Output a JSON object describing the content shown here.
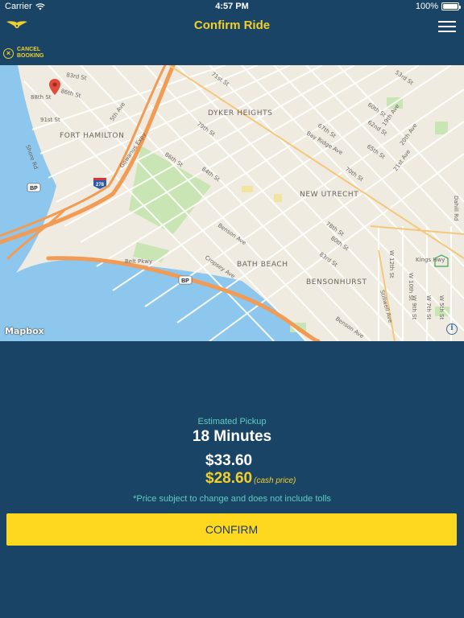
{
  "status_bar": {
    "carrier": "Carrier",
    "time": "4:57 PM",
    "battery": "100%",
    "wifi_icon": "wifi-icon",
    "battery_icon": "battery-icon"
  },
  "nav": {
    "title": "Confirm Ride",
    "logo_icon": "winged-logo-icon",
    "menu_icon": "hamburger-menu-icon"
  },
  "cancel": {
    "label": "CANCEL BOOKING",
    "icon": "close-circle-icon"
  },
  "map": {
    "attribution": "Mapbox",
    "info_icon": "info-icon",
    "pin_icon": "map-pin-icon",
    "labels": {
      "fort_hamilton": "FORT HAMILTON",
      "dyker_heights": "DYKER HEIGHTS",
      "new_utrecht": "NEW UTRECHT",
      "bath_beach": "BATH BEACH",
      "bensonhurst": "BENSONHURST",
      "gowanus": "Gowanus Expy",
      "belt_pkwy": "Belt Pkwy",
      "bp1": "BP",
      "bp2": "BP",
      "i278": "278",
      "shore_rd": "Shore Rd",
      "st_71": "71st St",
      "st_79": "79th St",
      "st_86a": "86th St",
      "st_86b": "86th St",
      "st_84": "84th St",
      "st_88": "88th St",
      "st_91": "91st St",
      "st_83": "83rd St",
      "st_80": "80th St",
      "st_78": "78th St",
      "st_67": "67th St",
      "st_70": "70th St",
      "st_65": "65th St",
      "st_60": "60th St",
      "st_62": "62nd St",
      "st_53": "53rd St",
      "ave_5": "5th Ave",
      "ave_19": "19th Ave",
      "ave_20": "20th Ave",
      "ave_21": "21st Ave",
      "bay_ridge": "Bay Ridge Ave",
      "benson_ave": "Benson Ave",
      "cropsey": "Cropsey Ave",
      "stillwell": "Stillwell Ave",
      "kings_hwy": "Kings Hwy",
      "w12": "W 12th St",
      "w9": "W 9th St",
      "w7": "W 7th St",
      "w5": "W 5th St",
      "w10": "W 10th St",
      "dahill": "Dahill Rd"
    }
  },
  "pickup": {
    "label": "Estimated Pickup",
    "value": "18 Minutes"
  },
  "pricing": {
    "price": "$33.60",
    "cash_price": "$28.60",
    "cash_note": "(cash price)",
    "disclaimer": "*Price subject to change and does not include tolls"
  },
  "confirm": {
    "label": "CONFIRM"
  },
  "colors": {
    "background": "#1a4466",
    "accent_yellow": "#f3cf2b",
    "button_yellow": "#fed81f",
    "teal_text": "#5fcdc0"
  }
}
